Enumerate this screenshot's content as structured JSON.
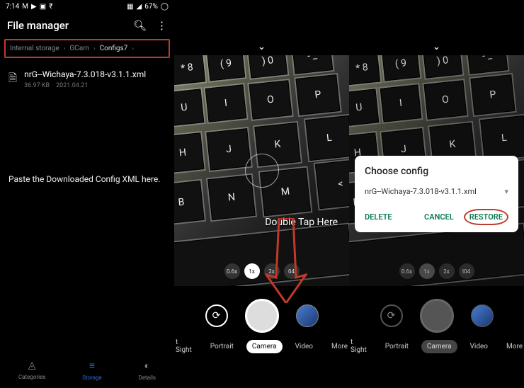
{
  "status_bar": {
    "time": "7:14",
    "battery": "67%"
  },
  "file_manager": {
    "title": "File manager",
    "breadcrumb": [
      "Internal storage",
      "GCam",
      "Configs7"
    ],
    "file": {
      "name": "nrG--Wichaya-7.3.018-v3.1.1.xml",
      "size": "36.97 KB",
      "date": "2021.04.21"
    },
    "instruction": "Paste the Downloaded Config XML here.",
    "bottom_nav": {
      "categories": "Categories",
      "storage": "Storage",
      "details": "Details"
    }
  },
  "camera": {
    "overlay_text": "Double Tap Here",
    "zoom": [
      "0.6x",
      "1x",
      "2x",
      "04"
    ],
    "modes": {
      "sight": "t Sight",
      "portrait": "Portrait",
      "camera": "Camera",
      "video": "Video",
      "more": "More"
    }
  },
  "camera2": {
    "zoom": [
      "0.6x",
      "1x",
      "2x",
      "I04"
    ],
    "modes": {
      "sight": "t Sight",
      "portrait": "Portrait",
      "camera": "Camera",
      "video": "Video",
      "more": "More"
    }
  },
  "dialog": {
    "title": "Choose config",
    "selected": "nrG--Wichaya-7.3.018-v3.1.1.xml",
    "delete": "DELETE",
    "cancel": "CANCEL",
    "restore": "RESTORE"
  }
}
